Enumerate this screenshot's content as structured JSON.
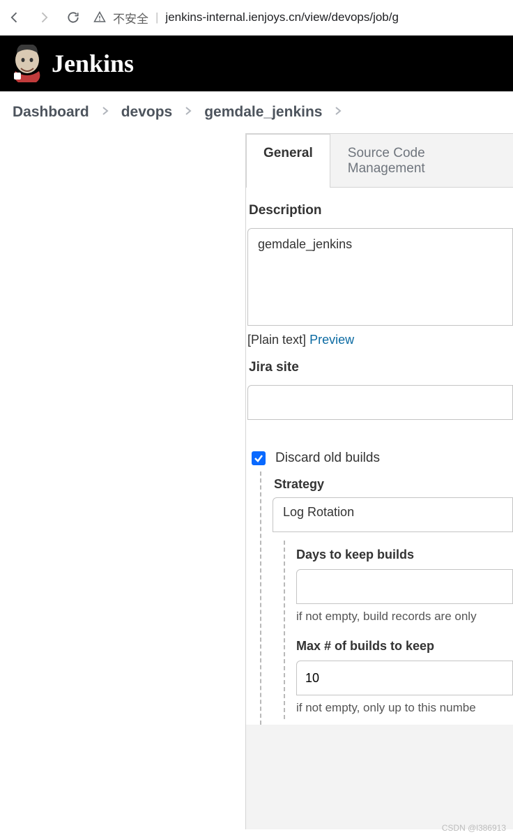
{
  "browser": {
    "security_label": "不安全",
    "url": "jenkins-internal.ienjoys.cn/view/devops/job/g"
  },
  "header": {
    "product": "Jenkins"
  },
  "breadcrumbs": [
    {
      "label": "Dashboard"
    },
    {
      "label": "devops"
    },
    {
      "label": "gemdale_jenkins"
    }
  ],
  "tabs": [
    {
      "label": "General",
      "active": true
    },
    {
      "label": "Source Code Management",
      "active": false
    }
  ],
  "form": {
    "description_label": "Description",
    "description_value": "gemdale_jenkins",
    "format_prefix": "[Plain text]",
    "preview_label": "Preview",
    "jira_label": "Jira site",
    "jira_value": "",
    "discard_label": "Discard old builds",
    "discard_checked": true,
    "strategy_label": "Strategy",
    "strategy_value": "Log Rotation",
    "days_label": "Days to keep builds",
    "days_value": "",
    "days_help": "if not empty, build records are only",
    "max_label": "Max # of builds to keep",
    "max_value": "10",
    "max_help": "if not empty, only up to this numbe"
  },
  "watermark": "CSDN @l386913"
}
